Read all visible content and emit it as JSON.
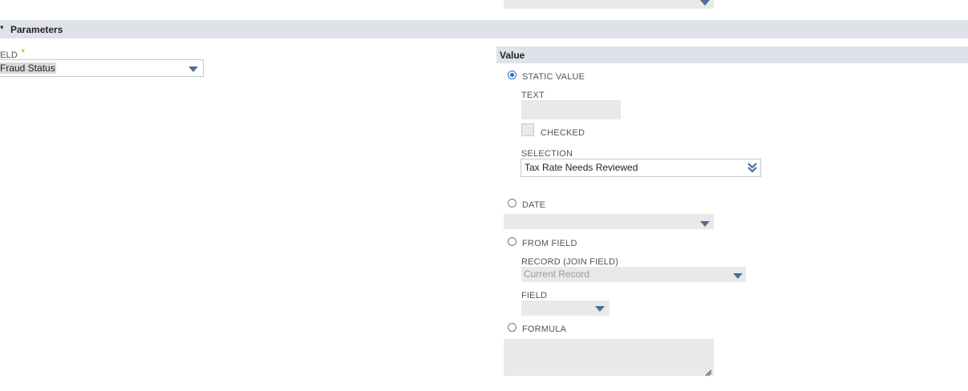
{
  "parameters": {
    "title": "Parameters",
    "field_label": "ELD",
    "required_mark": "*",
    "field_value": "Fraud Status"
  },
  "value_panel": {
    "title": "Value",
    "static_value": {
      "label": "STATIC VALUE",
      "selected": true,
      "text_label": "TEXT",
      "text_value": "",
      "checked_label": "CHECKED",
      "checked": false,
      "selection_label": "SELECTION",
      "selection_value": "Tax Rate Needs Reviewed"
    },
    "date": {
      "label": "DATE",
      "selected": false,
      "value": ""
    },
    "from_field": {
      "label": "FROM FIELD",
      "selected": false,
      "record_label": "RECORD (JOIN FIELD)",
      "record_value": "Current Record",
      "field_label": "FIELD",
      "field_value": ""
    },
    "formula": {
      "label": "FORMULA",
      "selected": false,
      "value": ""
    }
  }
}
